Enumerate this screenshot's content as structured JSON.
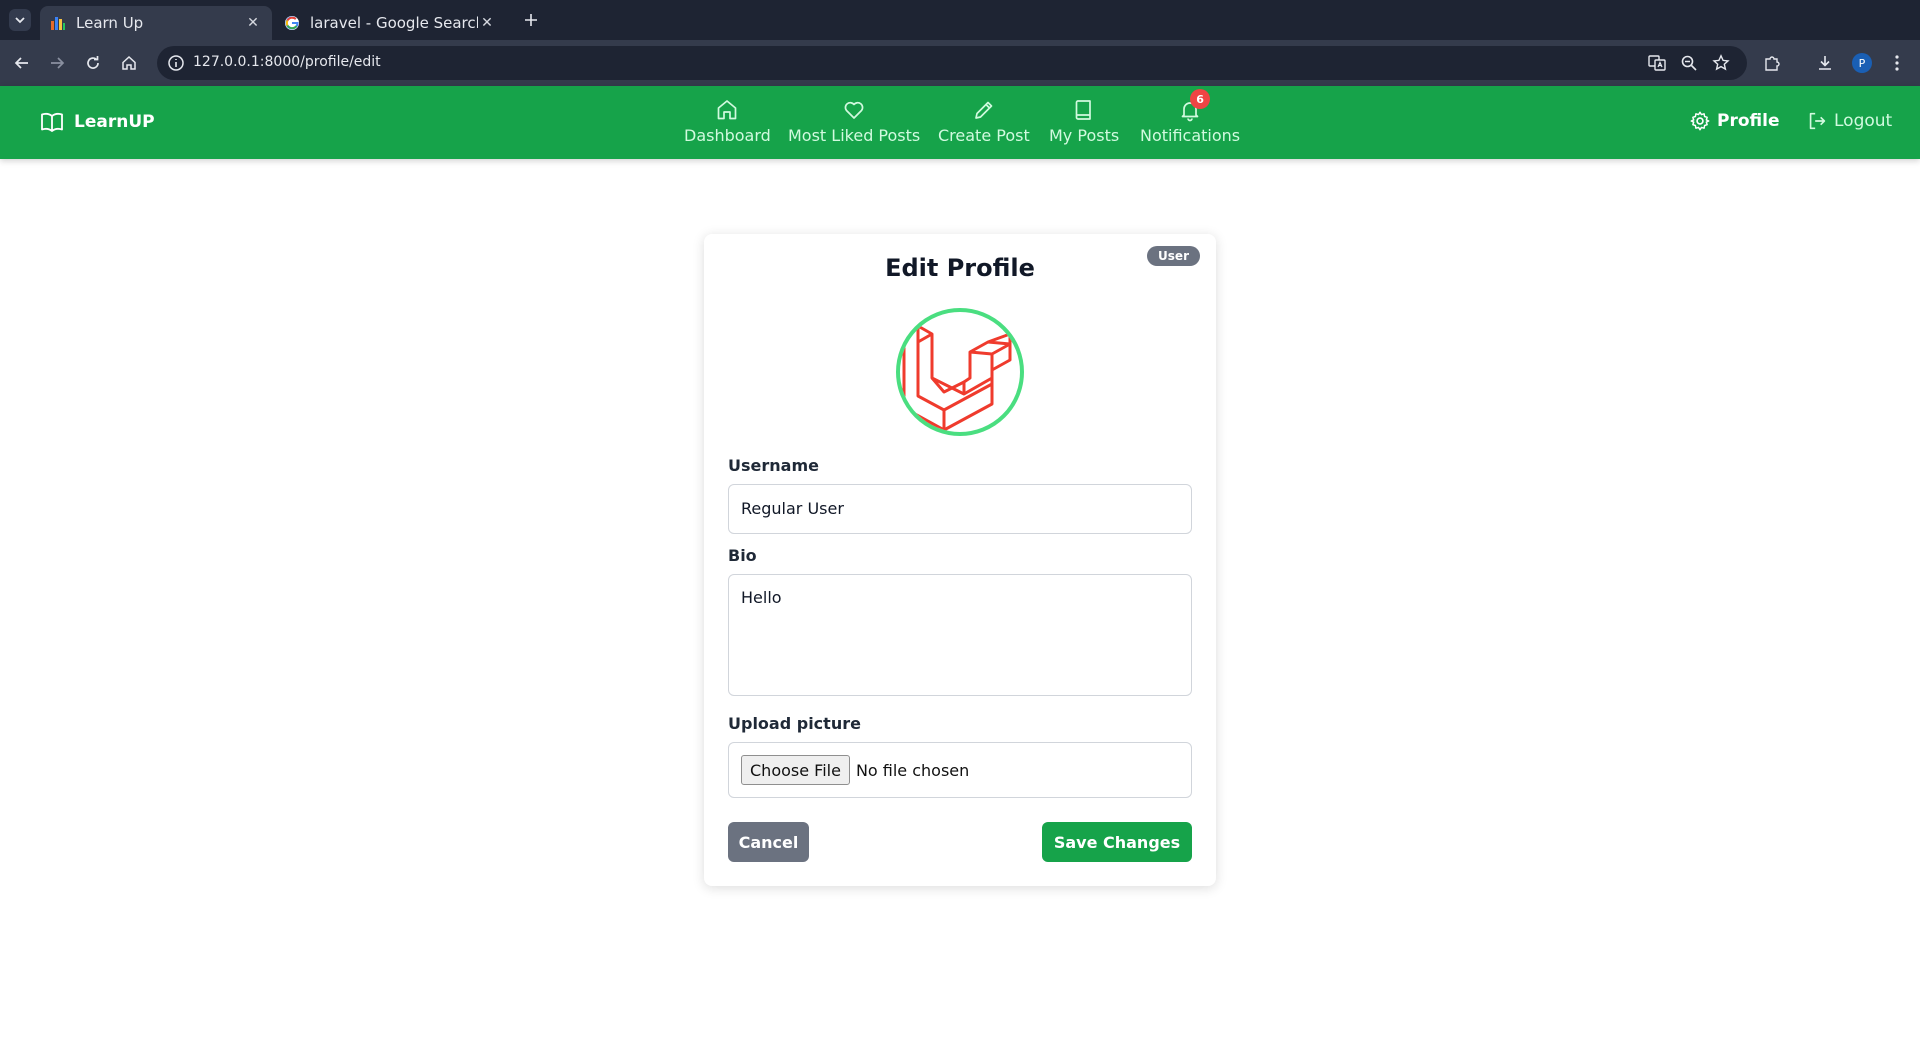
{
  "browser": {
    "tabs": [
      {
        "title": "Learn Up",
        "active": true,
        "icon": "learnup-favicon"
      },
      {
        "title": "laravel - Google Search",
        "active": false,
        "icon": "google-favicon"
      }
    ],
    "url": "127.0.0.1:8000/profile/edit",
    "profile_initial": "P"
  },
  "app": {
    "brand": "LearnUP",
    "nav": [
      {
        "label": "Dashboard",
        "icon": "home-icon"
      },
      {
        "label": "Most Liked Posts",
        "icon": "heart-icon"
      },
      {
        "label": "Create Post",
        "icon": "pencil-icon"
      },
      {
        "label": "My Posts",
        "icon": "book-icon"
      },
      {
        "label": "Notifications",
        "icon": "bell-icon",
        "badge": "6"
      }
    ],
    "profile_link": "Profile",
    "logout_link": "Logout"
  },
  "form": {
    "title": "Edit Profile",
    "role_badge": "User",
    "avatar": "laravel-logo",
    "username_label": "Username",
    "username_value": "Regular User",
    "bio_label": "Bio",
    "bio_value": "Hello",
    "upload_label": "Upload picture",
    "choose_file": "Choose File",
    "file_status": "No file chosen",
    "cancel": "Cancel",
    "save": "Save Changes"
  },
  "colors": {
    "brand_green": "#16a34a",
    "badge_red": "#ef4444",
    "avatar_ring": "#4ade80",
    "laravel_red": "#ef3b2d",
    "neutral_button": "#6b7280"
  }
}
